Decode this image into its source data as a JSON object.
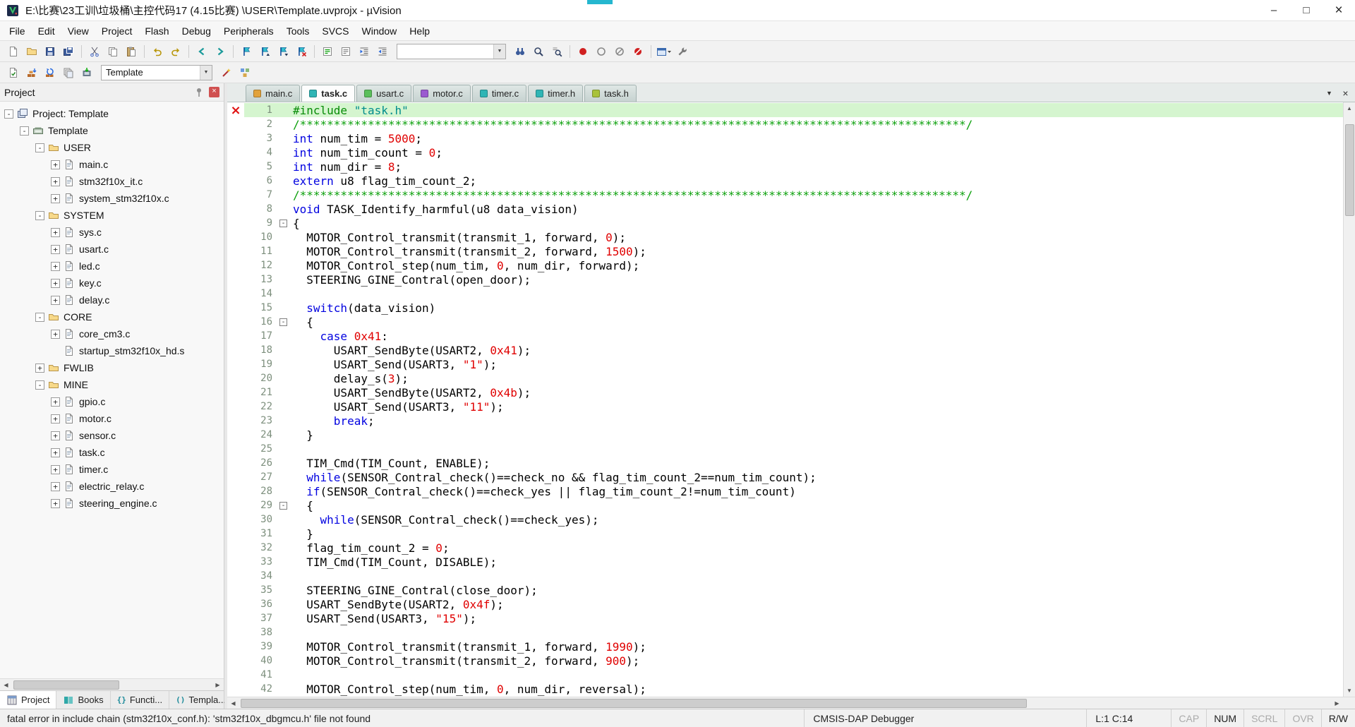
{
  "colors": {
    "keyword": "#0202e0",
    "number": "#e00000",
    "string": "#e00000",
    "comment": "#0ca00c",
    "directive": "#078c07",
    "include_string": "#008c8c",
    "line_highlight": "#d5f5cf",
    "line_number": "#7d8f7d",
    "error_marker": "#e01010",
    "titlebar_artifact": "#25b7cf",
    "tab_accent": "#2fb5b5"
  },
  "titlebar": {
    "title": "E:\\比赛\\23工训\\垃圾桶\\主控代码17  (4.15比赛) \\USER\\Template.uvprojx - µVision",
    "controls": [
      "minimize",
      "maximize",
      "close"
    ]
  },
  "menu": {
    "items": [
      "File",
      "Edit",
      "View",
      "Project",
      "Flash",
      "Debug",
      "Peripherals",
      "Tools",
      "SVCS",
      "Window",
      "Help"
    ]
  },
  "toolbar1": {
    "groups_left": [
      [
        "new-file",
        "open-file",
        "save",
        "save-all"
      ],
      [
        "cut",
        "copy",
        "paste"
      ],
      [
        "undo",
        "redo"
      ],
      [
        "navigate-back",
        "navigate-forward"
      ],
      [
        "bookmark-toggle",
        "bookmark-previous",
        "bookmark-next",
        "bookmark-clear-all"
      ],
      [
        "comment-selection",
        "uncomment-selection",
        "indent",
        "unindent"
      ]
    ],
    "find_combo": {
      "value": "",
      "width": 155
    },
    "groups_right": [
      [
        "find-in-files",
        "find",
        "incremental-find"
      ],
      [
        "breakpoint-toggle",
        "breakpoint-enable-disable",
        "breakpoint-disable-all",
        "breakpoint-kill-all"
      ],
      [
        "window-select",
        "configure"
      ]
    ]
  },
  "toolbar2": {
    "groups_left": [
      [
        "translate",
        "build",
        "rebuild",
        "batch-build",
        "download"
      ]
    ],
    "target_combo": {
      "value": "Template",
      "width": 158
    },
    "groups_right": [
      [
        "options-for-target",
        "manage-project-items"
      ]
    ]
  },
  "panel": {
    "title": "Project"
  },
  "project_tree": [
    {
      "label": "Project: Template",
      "depth": 0,
      "icon": "workspace",
      "expand": "minus"
    },
    {
      "label": "Template",
      "depth": 1,
      "icon": "target",
      "expand": "minus"
    },
    {
      "label": "USER",
      "depth": 2,
      "icon": "folder",
      "expand": "minus"
    },
    {
      "label": "main.c",
      "depth": 3,
      "icon": "file",
      "expand": "plus"
    },
    {
      "label": "stm32f10x_it.c",
      "depth": 3,
      "icon": "file",
      "expand": "plus"
    },
    {
      "label": "system_stm32f10x.c",
      "depth": 3,
      "icon": "file",
      "expand": "plus"
    },
    {
      "label": "SYSTEM",
      "depth": 2,
      "icon": "folder",
      "expand": "minus"
    },
    {
      "label": "sys.c",
      "depth": 3,
      "icon": "file",
      "expand": "plus"
    },
    {
      "label": "usart.c",
      "depth": 3,
      "icon": "file",
      "expand": "plus"
    },
    {
      "label": "led.c",
      "depth": 3,
      "icon": "file",
      "expand": "plus"
    },
    {
      "label": "key.c",
      "depth": 3,
      "icon": "file",
      "expand": "plus"
    },
    {
      "label": "delay.c",
      "depth": 3,
      "icon": "file",
      "expand": "plus"
    },
    {
      "label": "CORE",
      "depth": 2,
      "icon": "folder",
      "expand": "minus"
    },
    {
      "label": "core_cm3.c",
      "depth": 3,
      "icon": "file",
      "expand": "plus"
    },
    {
      "label": "startup_stm32f10x_hd.s",
      "depth": 3,
      "icon": "file",
      "expand": "none"
    },
    {
      "label": "FWLIB",
      "depth": 2,
      "icon": "folder",
      "expand": "plus"
    },
    {
      "label": "MINE",
      "depth": 2,
      "icon": "folder",
      "expand": "minus"
    },
    {
      "label": "gpio.c",
      "depth": 3,
      "icon": "file",
      "expand": "plus"
    },
    {
      "label": "motor.c",
      "depth": 3,
      "icon": "file",
      "expand": "plus"
    },
    {
      "label": "sensor.c",
      "depth": 3,
      "icon": "file",
      "expand": "plus"
    },
    {
      "label": "task.c",
      "depth": 3,
      "icon": "file",
      "expand": "plus"
    },
    {
      "label": "timer.c",
      "depth": 3,
      "icon": "file",
      "expand": "plus"
    },
    {
      "label": "electric_relay.c",
      "depth": 3,
      "icon": "file",
      "expand": "plus"
    },
    {
      "label": "steering_engine.c",
      "depth": 3,
      "icon": "file",
      "expand": "plus"
    }
  ],
  "editor_tabs": [
    {
      "label": "main.c",
      "icon_color": "#e2a23b",
      "active": false
    },
    {
      "label": "task.c",
      "icon_color": "#2fb5b5",
      "active": true
    },
    {
      "label": "usart.c",
      "icon_color": "#5bbf5b",
      "active": false
    },
    {
      "label": "motor.c",
      "icon_color": "#9b59d0",
      "active": false
    },
    {
      "label": "timer.c",
      "icon_color": "#2fb5b5",
      "active": false
    },
    {
      "label": "timer.h",
      "icon_color": "#2fb5b5",
      "active": false
    },
    {
      "label": "task.h",
      "icon_color": "#a9c23a",
      "active": false
    }
  ],
  "editor_tabbar_controls": [
    "tab-list",
    "close-tab"
  ],
  "editor": {
    "lines": [
      {
        "n": 1,
        "hl": true,
        "marker": "error",
        "seg": [
          [
            "d",
            "#include "
          ],
          [
            "i",
            "\"task.h\""
          ]
        ]
      },
      {
        "n": 2,
        "seg": [
          [
            "c",
            "/**************************************************************************************************/"
          ]
        ]
      },
      {
        "n": 3,
        "seg": [
          [
            "k",
            "int"
          ],
          [
            "p",
            " num_tim = "
          ],
          [
            "n",
            "5000"
          ],
          [
            "p",
            ";"
          ]
        ]
      },
      {
        "n": 4,
        "seg": [
          [
            "k",
            "int"
          ],
          [
            "p",
            " num_tim_count = "
          ],
          [
            "n",
            "0"
          ],
          [
            "p",
            ";"
          ]
        ]
      },
      {
        "n": 5,
        "seg": [
          [
            "k",
            "int"
          ],
          [
            "p",
            " num_dir = "
          ],
          [
            "n",
            "8"
          ],
          [
            "p",
            ";"
          ]
        ]
      },
      {
        "n": 6,
        "seg": [
          [
            "k",
            "extern"
          ],
          [
            "p",
            " u8 flag_tim_count_2;"
          ]
        ]
      },
      {
        "n": 7,
        "seg": [
          [
            "c",
            "/**************************************************************************************************/"
          ]
        ]
      },
      {
        "n": 8,
        "seg": [
          [
            "k",
            "void"
          ],
          [
            "p",
            " TASK_Identify_harmful(u8 data_vision)"
          ]
        ]
      },
      {
        "n": 9,
        "fold": true,
        "seg": [
          [
            "p",
            "{"
          ]
        ]
      },
      {
        "n": 10,
        "seg": [
          [
            "p",
            "  MOTOR_Control_transmit(transmit_1, forward, "
          ],
          [
            "n",
            "0"
          ],
          [
            "p",
            ");"
          ]
        ]
      },
      {
        "n": 11,
        "seg": [
          [
            "p",
            "  MOTOR_Control_transmit(transmit_2, forward, "
          ],
          [
            "n",
            "1500"
          ],
          [
            "p",
            ");"
          ]
        ]
      },
      {
        "n": 12,
        "seg": [
          [
            "p",
            "  MOTOR_Control_step(num_tim, "
          ],
          [
            "n",
            "0"
          ],
          [
            "p",
            ", num_dir, forward);"
          ]
        ]
      },
      {
        "n": 13,
        "seg": [
          [
            "p",
            "  STEERING_GINE_Contral(open_door);"
          ]
        ]
      },
      {
        "n": 14,
        "seg": []
      },
      {
        "n": 15,
        "seg": [
          [
            "p",
            "  "
          ],
          [
            "k",
            "switch"
          ],
          [
            "p",
            "(data_vision)"
          ]
        ]
      },
      {
        "n": 16,
        "fold": true,
        "seg": [
          [
            "p",
            "  {"
          ]
        ]
      },
      {
        "n": 17,
        "seg": [
          [
            "p",
            "    "
          ],
          [
            "k",
            "case"
          ],
          [
            "p",
            " "
          ],
          [
            "n",
            "0x41"
          ],
          [
            "p",
            ":"
          ]
        ]
      },
      {
        "n": 18,
        "seg": [
          [
            "p",
            "      USART_SendByte(USART2, "
          ],
          [
            "n",
            "0x41"
          ],
          [
            "p",
            ");"
          ]
        ]
      },
      {
        "n": 19,
        "seg": [
          [
            "p",
            "      USART_Send(USART3, "
          ],
          [
            "s",
            "\"1\""
          ],
          [
            "p",
            ");"
          ]
        ]
      },
      {
        "n": 20,
        "seg": [
          [
            "p",
            "      delay_s("
          ],
          [
            "n",
            "3"
          ],
          [
            "p",
            ");"
          ]
        ]
      },
      {
        "n": 21,
        "seg": [
          [
            "p",
            "      USART_SendByte(USART2, "
          ],
          [
            "n",
            "0x4b"
          ],
          [
            "p",
            ");"
          ]
        ]
      },
      {
        "n": 22,
        "seg": [
          [
            "p",
            "      USART_Send(USART3, "
          ],
          [
            "s",
            "\"11\""
          ],
          [
            "p",
            ");"
          ]
        ]
      },
      {
        "n": 23,
        "seg": [
          [
            "p",
            "      "
          ],
          [
            "k",
            "break"
          ],
          [
            "p",
            ";"
          ]
        ]
      },
      {
        "n": 24,
        "seg": [
          [
            "p",
            "  }"
          ]
        ]
      },
      {
        "n": 25,
        "seg": []
      },
      {
        "n": 26,
        "seg": [
          [
            "p",
            "  TIM_Cmd(TIM_Count, ENABLE);"
          ]
        ]
      },
      {
        "n": 27,
        "seg": [
          [
            "p",
            "  "
          ],
          [
            "k",
            "while"
          ],
          [
            "p",
            "(SENSOR_Contral_check()==check_no && flag_tim_count_2==num_tim_count);"
          ]
        ]
      },
      {
        "n": 28,
        "seg": [
          [
            "p",
            "  "
          ],
          [
            "k",
            "if"
          ],
          [
            "p",
            "(SENSOR_Contral_check()==check_yes || flag_tim_count_2!=num_tim_count)"
          ]
        ]
      },
      {
        "n": 29,
        "fold": true,
        "seg": [
          [
            "p",
            "  {"
          ]
        ]
      },
      {
        "n": 30,
        "seg": [
          [
            "p",
            "    "
          ],
          [
            "k",
            "while"
          ],
          [
            "p",
            "(SENSOR_Contral_check()==check_yes);"
          ]
        ]
      },
      {
        "n": 31,
        "seg": [
          [
            "p",
            "  }"
          ]
        ]
      },
      {
        "n": 32,
        "seg": [
          [
            "p",
            "  flag_tim_count_2 = "
          ],
          [
            "n",
            "0"
          ],
          [
            "p",
            ";"
          ]
        ]
      },
      {
        "n": 33,
        "seg": [
          [
            "p",
            "  TIM_Cmd(TIM_Count, DISABLE);"
          ]
        ]
      },
      {
        "n": 34,
        "seg": []
      },
      {
        "n": 35,
        "seg": [
          [
            "p",
            "  STEERING_GINE_Contral(close_door);"
          ]
        ]
      },
      {
        "n": 36,
        "seg": [
          [
            "p",
            "  USART_SendByte(USART2, "
          ],
          [
            "n",
            "0x4f"
          ],
          [
            "p",
            ");"
          ]
        ]
      },
      {
        "n": 37,
        "seg": [
          [
            "p",
            "  USART_Send(USART3, "
          ],
          [
            "s",
            "\"15\""
          ],
          [
            "p",
            ");"
          ]
        ]
      },
      {
        "n": 38,
        "seg": []
      },
      {
        "n": 39,
        "seg": [
          [
            "p",
            "  MOTOR_Control_transmit(transmit_1, forward, "
          ],
          [
            "n",
            "1990"
          ],
          [
            "p",
            ");"
          ]
        ]
      },
      {
        "n": 40,
        "seg": [
          [
            "p",
            "  MOTOR_Control_transmit(transmit_2, forward, "
          ],
          [
            "n",
            "900"
          ],
          [
            "p",
            ");"
          ]
        ]
      },
      {
        "n": 41,
        "seg": []
      },
      {
        "n": 42,
        "seg": [
          [
            "p",
            "  MOTOR_Control_step(num_tim, "
          ],
          [
            "n",
            "0"
          ],
          [
            "p",
            ", num_dir, reversal);"
          ]
        ]
      }
    ]
  },
  "bottom_tabs": [
    {
      "label": "Project",
      "icon": "project",
      "active": true
    },
    {
      "label": "Books",
      "icon": "books",
      "active": false
    },
    {
      "label": "Functi...",
      "icon": "functions",
      "active": false
    },
    {
      "label": "Templa...",
      "icon": "templates",
      "active": false
    }
  ],
  "statusbar": {
    "message": "fatal error in include chain (stm32f10x_conf.h): 'stm32f10x_dbgmcu.h' file not found",
    "debugger": "CMSIS-DAP Debugger",
    "cursor": "L:1 C:14",
    "flags": [
      {
        "label": "CAP",
        "active": false
      },
      {
        "label": "NUM",
        "active": true
      },
      {
        "label": "SCRL",
        "active": false
      },
      {
        "label": "OVR",
        "active": false
      },
      {
        "label": "R/W",
        "active": true
      }
    ]
  }
}
